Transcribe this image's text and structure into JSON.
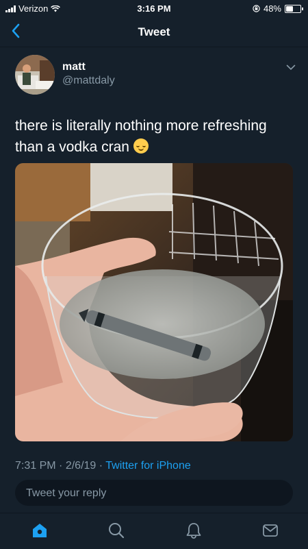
{
  "status_bar": {
    "carrier": "Verizon",
    "time": "3:16 PM",
    "battery_text": "48%",
    "battery_level": 0.48
  },
  "header": {
    "title": "Tweet"
  },
  "tweet": {
    "display_name": "matt",
    "handle": "@mattdaly",
    "text": "there is literally nothing more refreshing than a vodka cran",
    "emoji": "relieved-face",
    "time": "7:31 PM",
    "date": "2/6/19",
    "source": "Twitter for iPhone"
  },
  "reply": {
    "placeholder": "Tweet your reply"
  },
  "tab_bar": {
    "icons": [
      "home-icon",
      "search-icon",
      "notifications-icon",
      "messages-icon"
    ],
    "active": "home-icon"
  },
  "colors": {
    "background": "#15202b",
    "accent": "#1da1f2",
    "secondary_text": "#8899a6"
  }
}
